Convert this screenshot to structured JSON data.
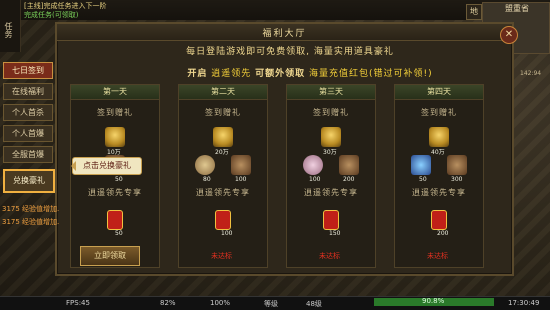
{
  "hud": {
    "quest_line1": "[主线]完成任务进入下一阶",
    "quest_line2": "完成任务(可领取)",
    "task_tab": "任务",
    "map_button": "地",
    "map_name": "盟重省",
    "coords": "142:94",
    "exp_messages": [
      "3175 经验值增加.",
      "3175 经验值增加."
    ]
  },
  "dialog": {
    "title": "福利大厅",
    "headline1": "每日登陆游戏即可免费领取, 海量实用道具豪礼",
    "headline2_prefix": "开启",
    "headline2_highlight1": "逍遥领先",
    "headline2_mid": "可额外领取",
    "headline2_highlight2": "海量充值红包(错过可补领!)",
    "close": "✕"
  },
  "tabs": [
    {
      "label": "七日签到",
      "active": true
    },
    {
      "label": "在线福利",
      "active": false
    },
    {
      "label": "个人首杀",
      "active": false
    },
    {
      "label": "个人首爆",
      "active": false
    },
    {
      "label": "全服首爆",
      "active": false
    },
    {
      "label": "兑换豪礼",
      "active": false,
      "highlight": true
    }
  ],
  "days": [
    {
      "title": "第一天",
      "sign_label": "签到赠礼",
      "gold_qty": "10万",
      "vip_label": "逍遥领先专享",
      "rewards": [
        {
          "icon": "beast",
          "qty": "50"
        }
      ],
      "vip_rewards": [
        {
          "icon": "redpack",
          "qty": "50"
        }
      ],
      "status": ""
    },
    {
      "title": "第二天",
      "sign_label": "签到赠礼",
      "gold_qty": "20万",
      "vip_label": "逍遥领先专享",
      "rewards": [
        {
          "icon": "shell",
          "qty": "80"
        },
        {
          "icon": "beast",
          "qty": "100"
        }
      ],
      "vip_rewards": [
        {
          "icon": "redpack",
          "qty": "100"
        }
      ],
      "status": "未达标"
    },
    {
      "title": "第三天",
      "sign_label": "签到赠礼",
      "gold_qty": "30万",
      "vip_label": "逍遥领先专享",
      "rewards": [
        {
          "icon": "lotus",
          "qty": "100"
        },
        {
          "icon": "beast",
          "qty": "200"
        }
      ],
      "vip_rewards": [
        {
          "icon": "redpack",
          "qty": "150"
        }
      ],
      "status": "未达标"
    },
    {
      "title": "第四天",
      "sign_label": "签到赠礼",
      "gold_qty": "40万",
      "vip_label": "逍遥领先专享",
      "rewards": [
        {
          "icon": "orb",
          "qty": "50"
        },
        {
          "icon": "beast",
          "qty": "300"
        }
      ],
      "vip_rewards": [
        {
          "icon": "redpack",
          "qty": "200"
        }
      ],
      "status": "未达标"
    }
  ],
  "tooltip": "点击兑换豪礼",
  "claim_button": "立即领取",
  "statusbar": {
    "fps": "FPS:45",
    "battery": "82%",
    "volume": "100%",
    "level_label": "等级",
    "level": "48级",
    "exp": "90.8%",
    "time": "17:30:49"
  }
}
